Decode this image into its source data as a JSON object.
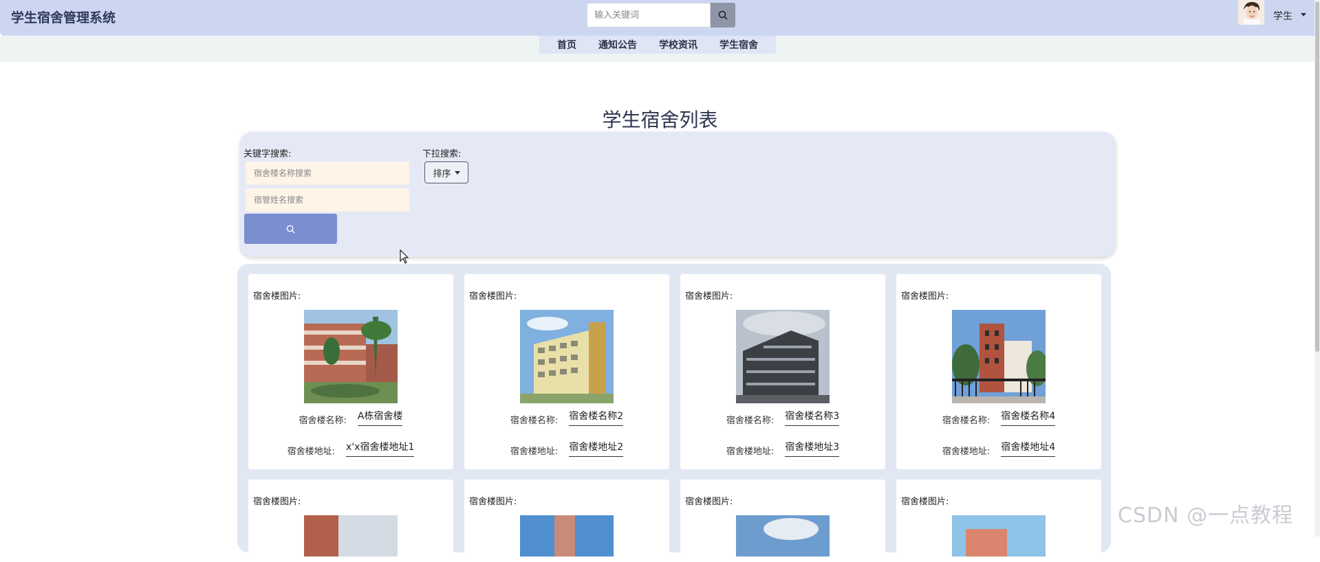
{
  "header": {
    "brand": "学生宿舍管理系统",
    "search_placeholder": "输入关键词",
    "user_label": "学生"
  },
  "nav": {
    "items": [
      {
        "label": "首页"
      },
      {
        "label": "通知公告"
      },
      {
        "label": "学校资讯"
      },
      {
        "label": "学生宿舍"
      }
    ]
  },
  "page": {
    "title": "学生宿舍列表"
  },
  "filters": {
    "keyword_label": "关键字搜索:",
    "building_name_placeholder": "宿舍楼名称搜索",
    "manager_name_placeholder": "宿管姓名搜索",
    "dropdown_label": "下拉搜索:",
    "sort_label": "排序"
  },
  "cards": {
    "picture_label": "宿舍楼图片:",
    "name_label": "宿舍楼名称:",
    "address_label": "宿舍楼地址:",
    "items": [
      {
        "name": "A栋宿舍楼",
        "address": "x'x宿舍楼地址1"
      },
      {
        "name": "宿舍楼名称2",
        "address": "宿舍楼地址2"
      },
      {
        "name": "宿舍楼名称3",
        "address": "宿舍楼地址3"
      },
      {
        "name": "宿舍楼名称4",
        "address": "宿舍楼地址4"
      }
    ]
  },
  "watermark": "CSDN @一点教程"
}
